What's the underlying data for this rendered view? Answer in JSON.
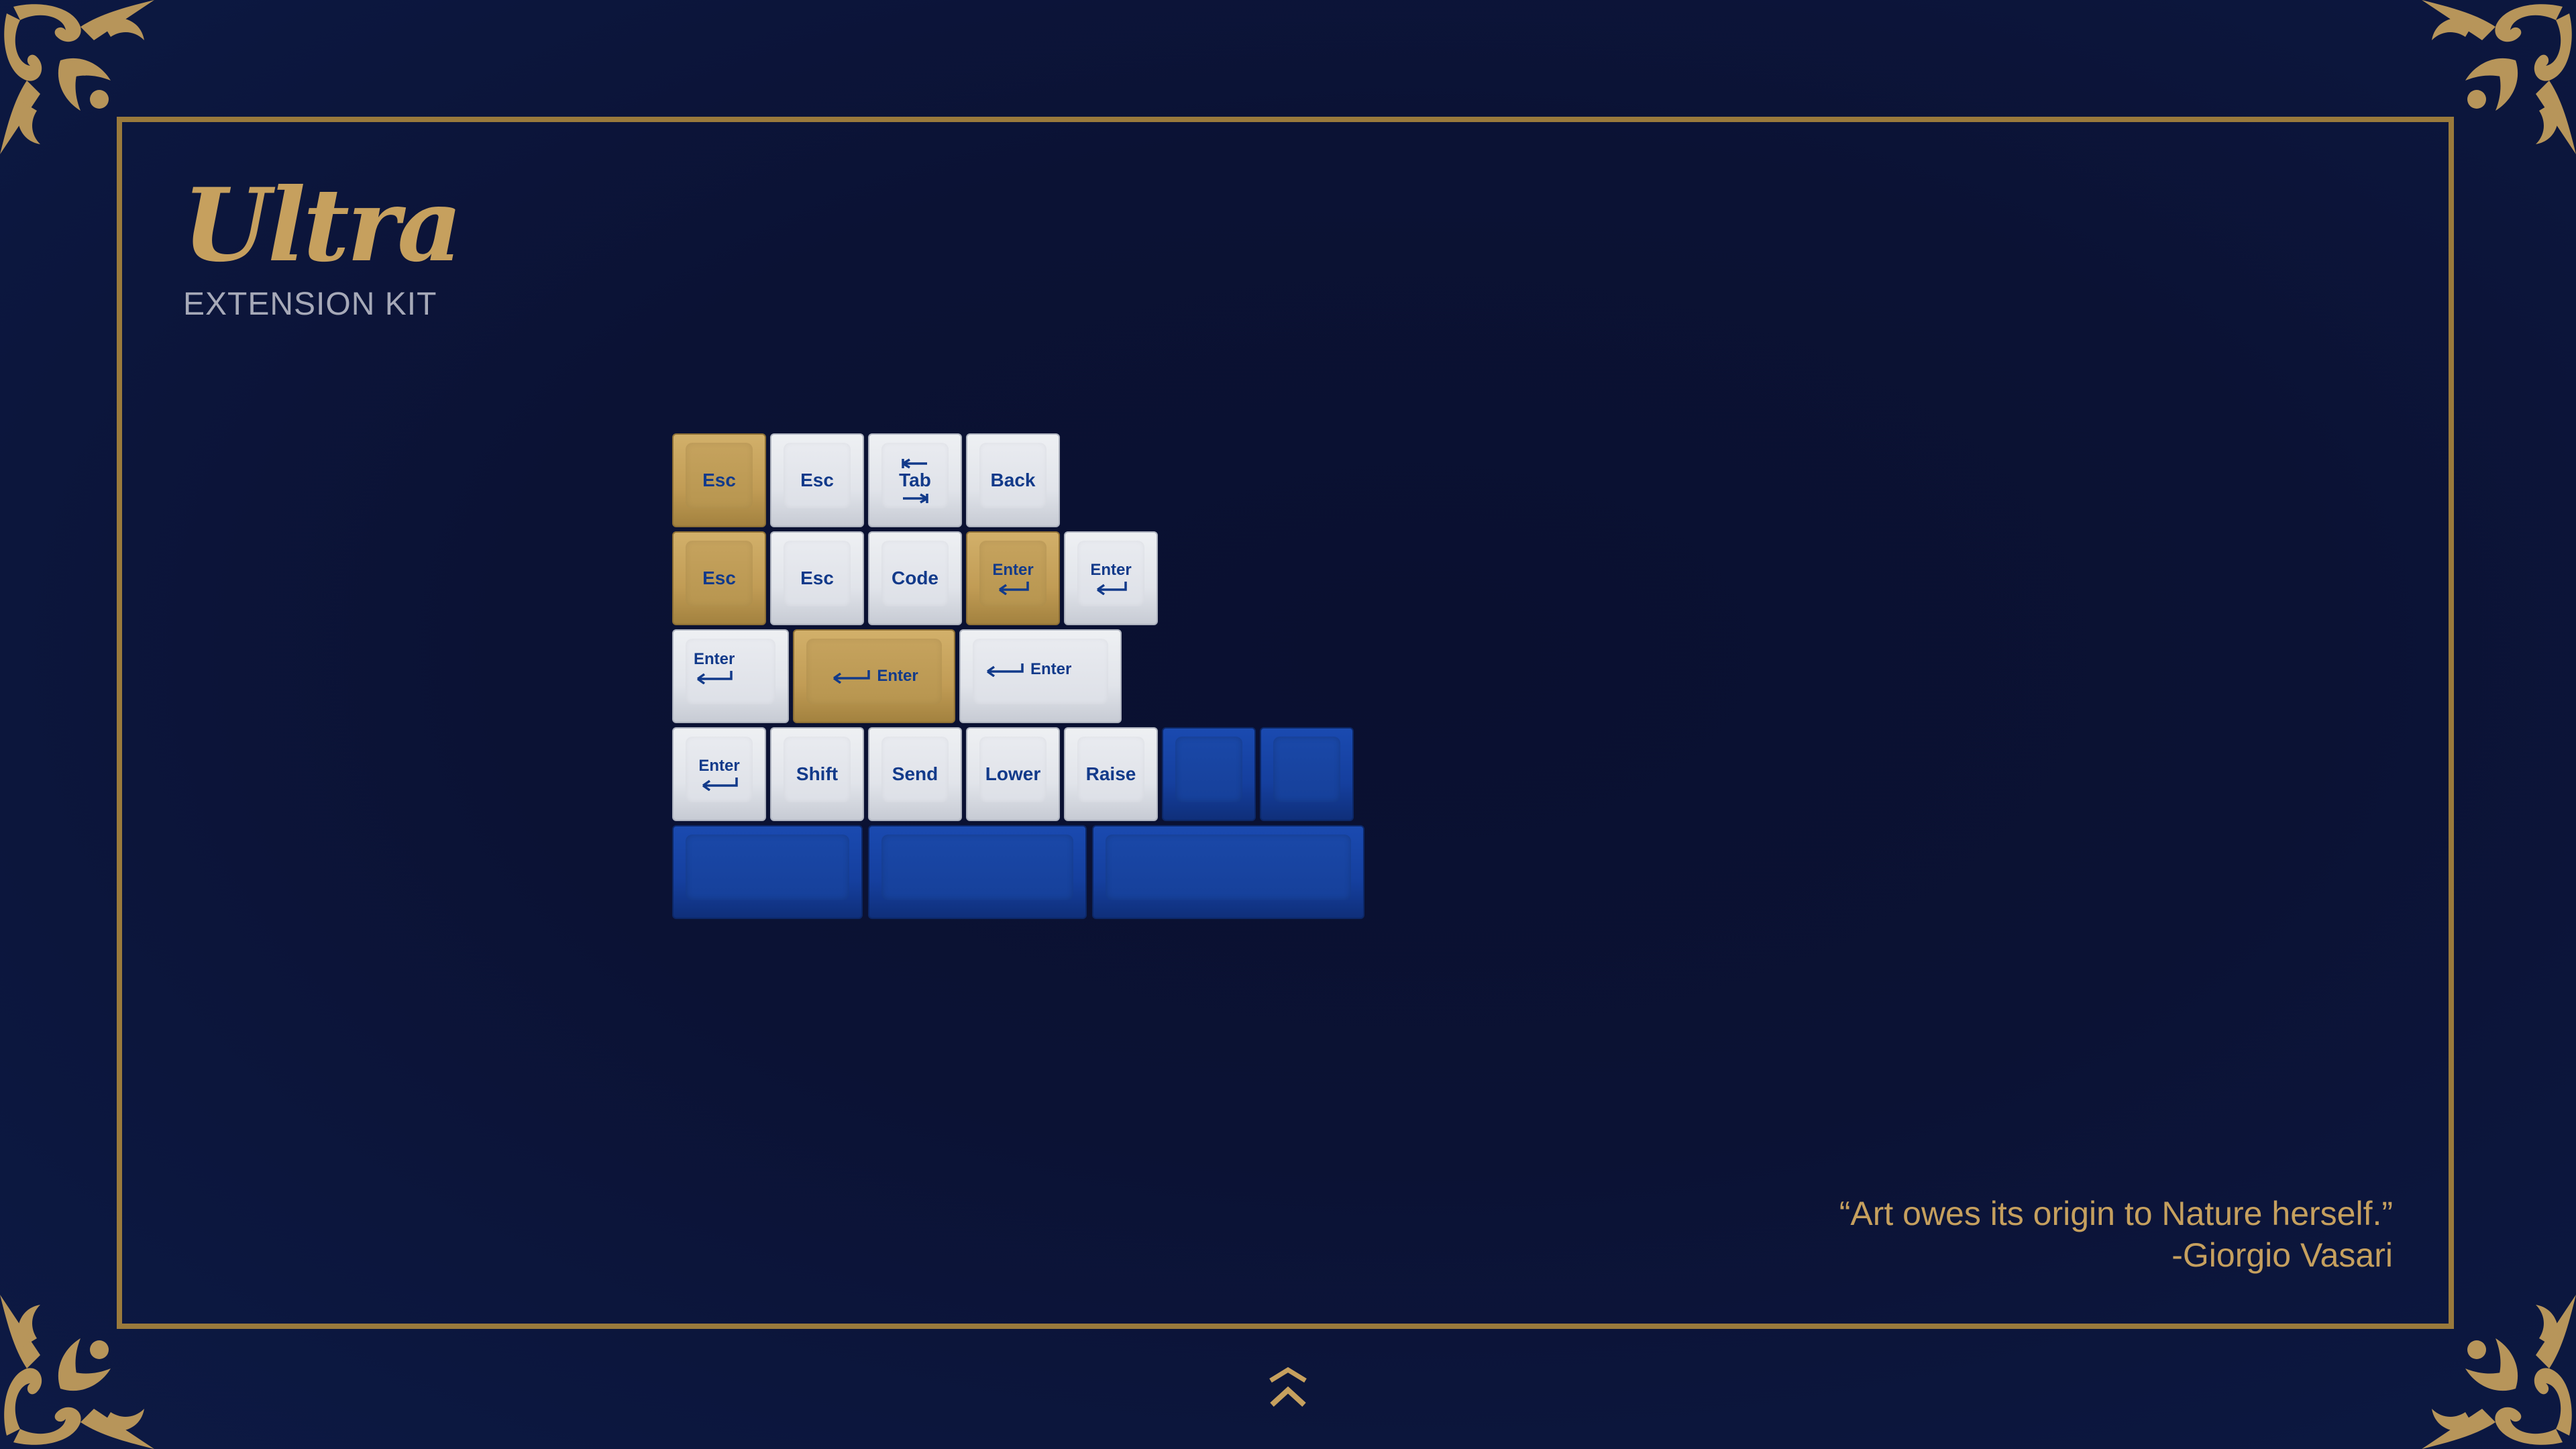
{
  "title": "Ultra",
  "subtitle": "EXTENSION KIT",
  "quote": {
    "text": "“Art owes its origin to Nature herself.”",
    "author": "-Giorgio Vasari"
  },
  "colors": {
    "background": "#0b1234",
    "gold": "#c6a05e",
    "frame": "#9a7a3c",
    "white_key": "#e3e6ec",
    "gold_key": "#c19c55",
    "blue_key": "#153f9e",
    "legend": "#123a8a"
  },
  "keycaps": {
    "row1": [
      "Esc",
      "Esc",
      "Tab",
      "Back"
    ],
    "row2": [
      "Esc",
      "Esc",
      "Code",
      "Enter",
      "Enter"
    ],
    "row3": [
      "Enter",
      "Enter",
      "Enter"
    ],
    "row4": [
      "Enter",
      "Shift",
      "Send",
      "Lower",
      "Raise",
      "",
      ""
    ],
    "row5": [
      "",
      "",
      ""
    ]
  },
  "logo_icon": "chevron-crown-icon",
  "corner_icon": "ornamental-flourish-icon"
}
